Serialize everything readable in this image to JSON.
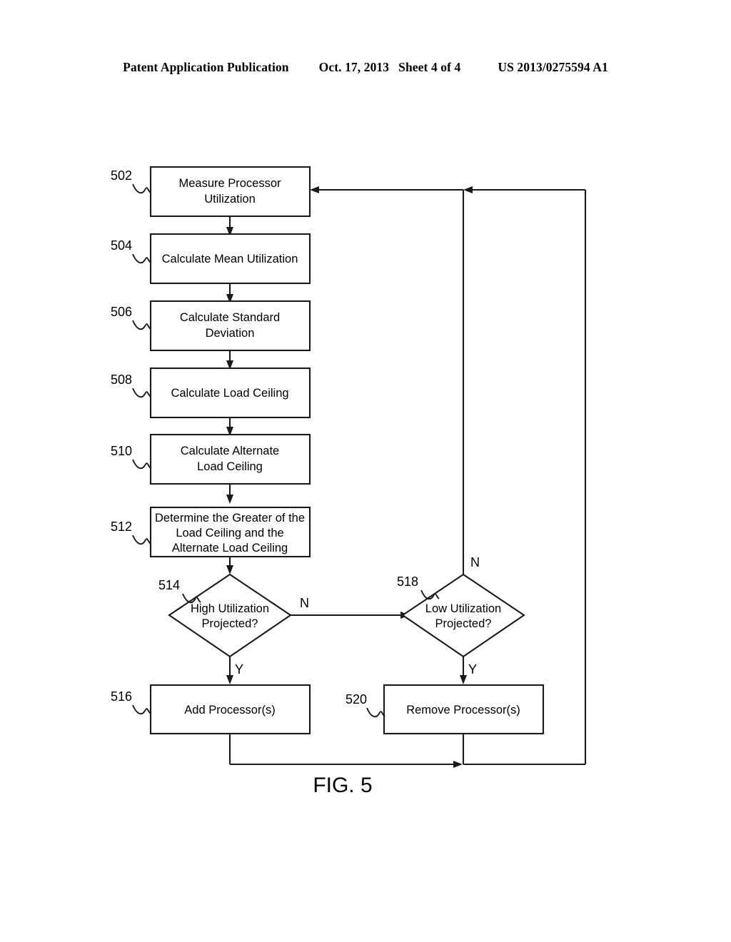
{
  "header": {
    "publication": "Patent Application Publication",
    "date": "Oct. 17, 2013",
    "sheet": "Sheet 4 of 4",
    "patent_number": "US 2013/0275594 A1"
  },
  "figure": {
    "caption": "FIG. 5"
  },
  "chart_data": {
    "type": "diagram",
    "title": "FIG. 5",
    "diagram_kind": "flowchart",
    "nodes": [
      {
        "ref": "502",
        "shape": "process",
        "label": "Measure Processor Utilization",
        "lines": [
          "Measure Processor",
          "Utilization"
        ]
      },
      {
        "ref": "504",
        "shape": "process",
        "label": "Calculate Mean Utilization",
        "lines": [
          "Calculate Mean Utilization"
        ]
      },
      {
        "ref": "506",
        "shape": "process",
        "label": "Calculate Standard Deviation",
        "lines": [
          "Calculate Standard",
          "Deviation"
        ]
      },
      {
        "ref": "508",
        "shape": "process",
        "label": "Calculate Load Ceiling",
        "lines": [
          "Calculate Load Ceiling"
        ]
      },
      {
        "ref": "510",
        "shape": "process",
        "label": "Calculate Alternate Load Ceiling",
        "lines": [
          "Calculate Alternate",
          "Load Ceiling"
        ]
      },
      {
        "ref": "512",
        "shape": "process",
        "label": "Determine the Greater of the Load Ceiling and the Alternate Load Ceiling",
        "lines": [
          "Determine the Greater of the",
          "Load Ceiling and the",
          "Alternate Load Ceiling"
        ]
      },
      {
        "ref": "514",
        "shape": "decision",
        "label": "High Utilization Projected?",
        "lines": [
          "High Utilization",
          "Projected?"
        ]
      },
      {
        "ref": "516",
        "shape": "process",
        "label": "Add Processor(s)",
        "lines": [
          "Add Processor(s)"
        ]
      },
      {
        "ref": "518",
        "shape": "decision",
        "label": "Low Utilization Projected?",
        "lines": [
          "Low Utilization",
          "Projected?"
        ]
      },
      {
        "ref": "520",
        "shape": "process",
        "label": "Remove Processor(s)",
        "lines": [
          "Remove Processor(s)"
        ]
      }
    ],
    "edges": [
      {
        "from": "502",
        "to": "504",
        "label": ""
      },
      {
        "from": "504",
        "to": "506",
        "label": ""
      },
      {
        "from": "506",
        "to": "508",
        "label": ""
      },
      {
        "from": "508",
        "to": "510",
        "label": ""
      },
      {
        "from": "510",
        "to": "512",
        "label": ""
      },
      {
        "from": "512",
        "to": "514",
        "label": ""
      },
      {
        "from": "514",
        "to": "516",
        "label": "Y"
      },
      {
        "from": "514",
        "to": "518",
        "label": "N"
      },
      {
        "from": "518",
        "to": "520",
        "label": "Y"
      },
      {
        "from": "518",
        "to": "502",
        "label": "N"
      },
      {
        "from": "516",
        "to": "502",
        "label": ""
      },
      {
        "from": "520",
        "to": "502",
        "label": ""
      }
    ],
    "branch_labels": [
      "N",
      "Y",
      "N",
      "Y"
    ]
  }
}
